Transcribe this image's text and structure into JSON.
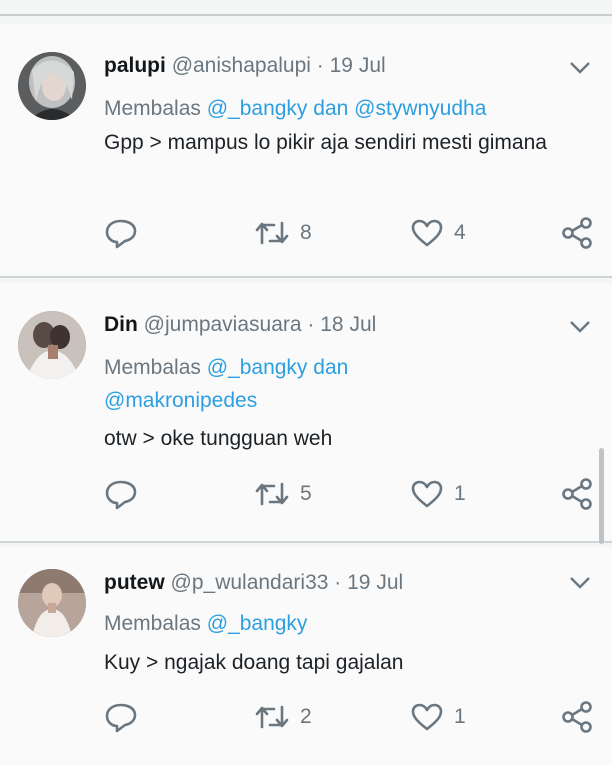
{
  "tweets": [
    {
      "name": "palupi",
      "handle": "@anishapalupi",
      "separator": "·",
      "date": "19 Jul",
      "reply_prefix": "Membalas",
      "reply_mention_1": "@_bangky",
      "reply_connector": "dan",
      "reply_mention_2": "@stywnyudha",
      "text": "Gpp > mampus lo pikir aja sendiri mesti gimana",
      "retweets": "8",
      "likes": "4",
      "avatar_icon": "avatar-photo-woman"
    },
    {
      "name": "Din",
      "handle": "@jumpaviasuara",
      "separator": "·",
      "date": "18 Jul",
      "reply_prefix": "Membalas",
      "reply_mention_1": "@_bangky",
      "reply_connector": "dan",
      "reply_mention_2": "@makronipedes",
      "text": "otw > oke tungguan weh",
      "retweets": "5",
      "likes": "1",
      "avatar_icon": "avatar-photo-couple"
    },
    {
      "name": "putew",
      "handle": "@p_wulandari33",
      "separator": "·",
      "date": "19 Jul",
      "reply_prefix": "Membalas",
      "reply_mention_1": "@_bangky",
      "text": "Kuy > ngajak doang tapi gajalan",
      "retweets": "2",
      "likes": "1",
      "avatar_icon": "avatar-photo-person"
    }
  ],
  "icons": {
    "reply": "reply-icon",
    "retweet": "retweet-icon",
    "like": "heart-icon",
    "share": "share-icon",
    "menu": "chevron-down-icon"
  },
  "colors": {
    "mention": "#2d9fe0",
    "secondary_text": "#6b7780",
    "primary_text": "#1d2227"
  }
}
